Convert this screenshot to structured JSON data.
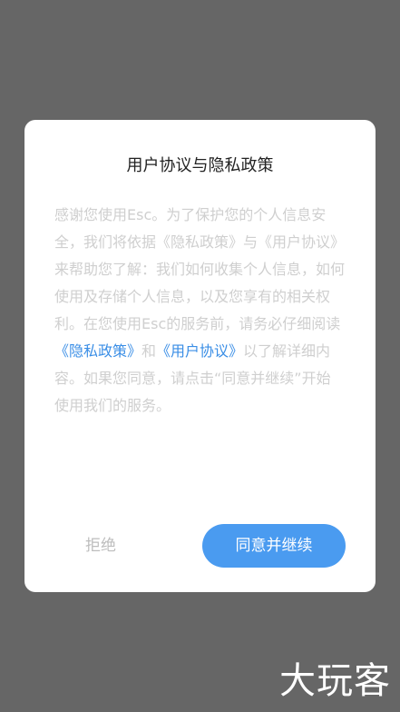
{
  "dialog": {
    "title": "用户协议与隐私政策",
    "body": {
      "part1": "感谢您使用Esc。为了保护您的个人信息安全，我们将依据《隐私政策》与《用户协议》来帮助您了解：我们如何收集个人信息，如何使用及存储个人信息，以及您享有的相关权利。在您使用Esc的服务前，请务必仔细阅读",
      "privacy_link": "《隐私政策》",
      "conjunction": "和",
      "agreement_link": "《用户协议》",
      "part2": "以了解详细内容。如果您同意，请点击“同意并继续”开始使用我们的服务。"
    },
    "reject_label": "拒绝",
    "agree_label": "同意并继续"
  },
  "watermark": "大玩客",
  "colors": {
    "overlay": "#666666",
    "accent": "#4a9bf0",
    "link": "#3a8ee6"
  }
}
